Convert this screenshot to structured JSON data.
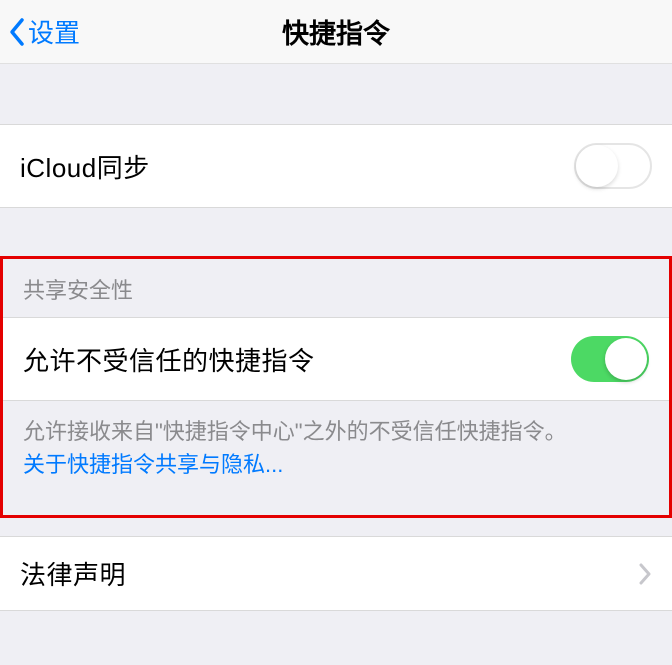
{
  "nav": {
    "back_label": "设置",
    "title": "快捷指令"
  },
  "icloud": {
    "label": "iCloud同步",
    "enabled": false
  },
  "security": {
    "header": "共享安全性",
    "allow_untrusted_label": "允许不受信任的快捷指令",
    "allow_untrusted_enabled": true,
    "footer_text": "允许接收来自\"快捷指令中心\"之外的不受信任快捷指令。",
    "footer_link": "关于快捷指令共享与隐私..."
  },
  "legal": {
    "label": "法律声明"
  }
}
